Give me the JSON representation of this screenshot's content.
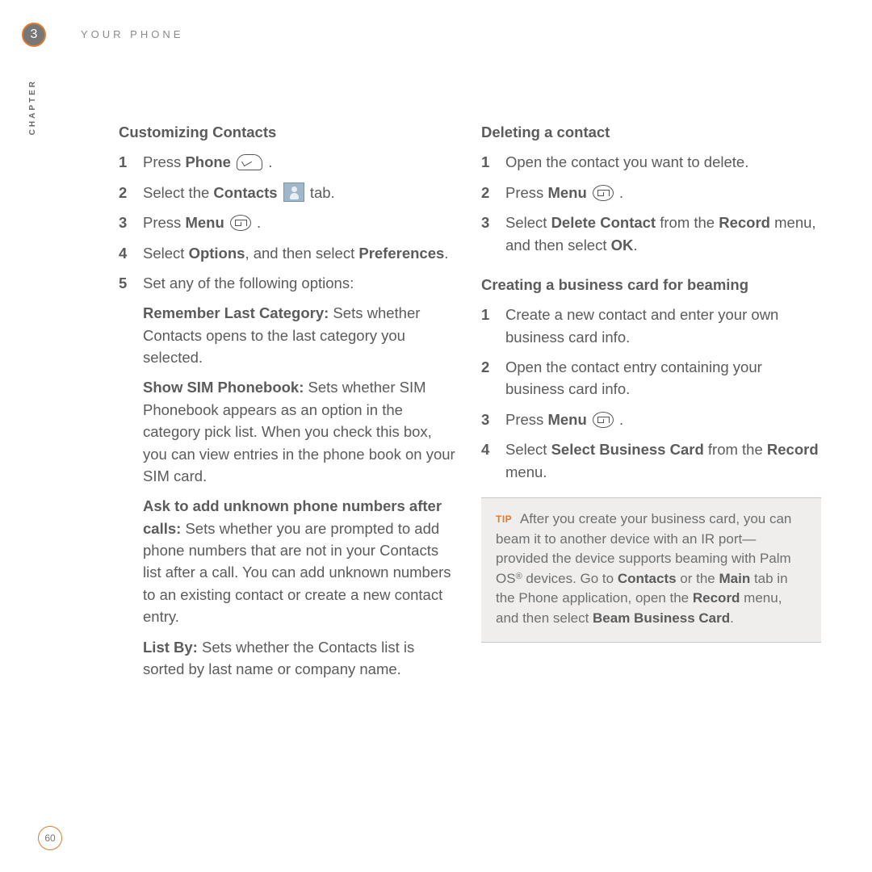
{
  "header": {
    "chapter_number": "3",
    "title": "YOUR PHONE",
    "side_label": "CHAPTER",
    "page_number": "60"
  },
  "left": {
    "heading": "Customizing Contacts",
    "steps": {
      "s1": {
        "num": "1",
        "pre": "Press ",
        "bold": "Phone",
        "post": " ."
      },
      "s2": {
        "num": "2",
        "pre": "Select the ",
        "bold": "Contacts",
        "post": " tab."
      },
      "s3": {
        "num": "3",
        "pre": "Press ",
        "bold": "Menu",
        "post": " ."
      },
      "s4": {
        "num": "4",
        "pre": "Select ",
        "b1": "Options",
        "mid": ", and then select ",
        "b2": "Preferences",
        "post": "."
      },
      "s5": {
        "num": "5",
        "text": "Set any of the following options:"
      }
    },
    "options": {
      "o1": {
        "label": "Remember Last Category:",
        "text": " Sets whether Contacts opens to the last category you selected."
      },
      "o2": {
        "label": "Show SIM Phonebook:",
        "text": " Sets whether SIM Phonebook appears as an option in the category pick list. When you check this box, you can view entries in the phone book on your SIM card."
      },
      "o3": {
        "label": "Ask to add unknown phone numbers after calls:",
        "text": " Sets whether you are prompted to add phone numbers that are not in your Contacts list after a call. You can add unknown numbers to an existing contact or create a new contact entry."
      },
      "o4": {
        "label": "List By:",
        "text": " Sets whether the Contacts list is sorted by last name or company name."
      }
    }
  },
  "right": {
    "del": {
      "heading": "Deleting a contact",
      "s1": {
        "num": "1",
        "text": "Open the contact you want to delete."
      },
      "s2": {
        "num": "2",
        "pre": "Press ",
        "bold": "Menu",
        "post": " ."
      },
      "s3": {
        "num": "3",
        "pre": "Select ",
        "b1": "Delete Contact",
        "mid": " from the ",
        "b2": "Record",
        "mid2": " menu, and then select ",
        "b3": "OK",
        "post": "."
      }
    },
    "biz": {
      "heading": "Creating a business card for beaming",
      "s1": {
        "num": "1",
        "text": "Create a new contact and enter your own business card info."
      },
      "s2": {
        "num": "2",
        "text": "Open the contact entry containing your business card info."
      },
      "s3": {
        "num": "3",
        "pre": "Press ",
        "bold": "Menu",
        "post": " ."
      },
      "s4": {
        "num": "4",
        "pre": "Select ",
        "b1": "Select Business Card",
        "mid": " from the ",
        "b2": "Record",
        "post": " menu."
      }
    },
    "tip": {
      "label": "TIP",
      "t1": " After you create your business card, you can beam it to another device with an IR port—provided the device supports beaming with Palm OS",
      "reg": "®",
      "t2": " devices. Go to ",
      "b1": "Contacts",
      "t3": " or the ",
      "b2": "Main",
      "t4": " tab in the Phone application, open the ",
      "b3": "Record",
      "t5": " menu, and then select ",
      "b4": "Beam Business Card",
      "t6": "."
    }
  }
}
